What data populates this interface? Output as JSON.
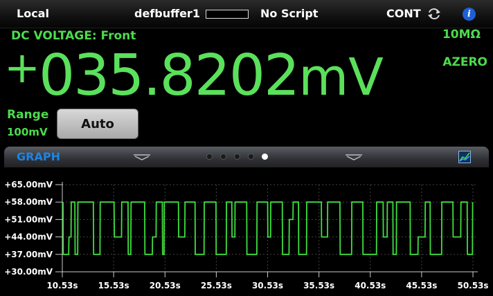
{
  "status_bar": {
    "mode": "Local",
    "buffer_name": "defbuffer1",
    "script": "No Script",
    "trigger_mode": "CONT",
    "sync_icon": "sync-arrows-icon",
    "info_icon": "info-icon",
    "info_glyph": "i"
  },
  "measurement": {
    "function": "DC VOLTAGE: Front",
    "sign": "+",
    "value": "035.8202",
    "unit": "mV",
    "input_impedance": "10MΩ",
    "autozero": "AZERO"
  },
  "range": {
    "label": "Range",
    "value": "100mV",
    "button_label": "Auto"
  },
  "swipe_panel": {
    "title": "GRAPH",
    "page_count": 5,
    "active_page": 5,
    "graph_settings_icon": "graph-icon"
  },
  "colors": {
    "reading": "#5be05b",
    "trace": "#3fe03f",
    "panel_title": "#1d84e3"
  },
  "chart_data": {
    "type": "line",
    "title": "",
    "xlabel": "",
    "ylabel": "",
    "y_tick_labels": [
      "+65.00mV",
      "+58.00mV",
      "+51.00mV",
      "+44.00mV",
      "+37.00mV",
      "+30.00mV"
    ],
    "y_ticks": [
      65,
      58,
      51,
      44,
      37,
      30
    ],
    "x_tick_labels": [
      "10.53s",
      "15.53s",
      "20.53s",
      "25.53s",
      "30.53s",
      "35.53s",
      "40.53s",
      "45.53s",
      "50.53s"
    ],
    "x_ticks": [
      10.53,
      15.53,
      20.53,
      25.53,
      30.53,
      35.53,
      40.53,
      45.53,
      50.53
    ],
    "xlim": [
      10.53,
      51.0
    ],
    "ylim": [
      30,
      65
    ],
    "grid": true,
    "series": [
      {
        "values_x": [
          10.6,
          10.62,
          11.15,
          11.18,
          11.38,
          11.4,
          11.75,
          11.78,
          12.03,
          12.05,
          13.55,
          13.58,
          14.2,
          14.22,
          15.57,
          15.6,
          16.3,
          16.32,
          16.93,
          16.95,
          17.2,
          17.23,
          18.55,
          18.58,
          19.3,
          19.32,
          19.66,
          19.68,
          20.27,
          20.3,
          20.44,
          20.46,
          21.84,
          21.86,
          22.46,
          22.48,
          23.46,
          23.48,
          24.34,
          24.36,
          25.5,
          25.52,
          26.5,
          26.52,
          27.04,
          27.06,
          27.34,
          27.36,
          28.49,
          28.51,
          29.48,
          29.5,
          30.53,
          30.55,
          30.82,
          30.84,
          31.96,
          31.98,
          32.61,
          32.64,
          33.0,
          33.02,
          33.54,
          33.56,
          34.32,
          34.34,
          35.76,
          35.78,
          36.36,
          36.38,
          37.57,
          37.6,
          38.71,
          38.73,
          39.8,
          39.82,
          41.13,
          41.15,
          41.78,
          41.8,
          42.17,
          42.19,
          42.73,
          42.75,
          43.07,
          43.09,
          44.41,
          44.43,
          45.17,
          45.19,
          45.87,
          45.89,
          46.36,
          46.38,
          47.48,
          47.5,
          48.58,
          48.6,
          49.34,
          49.36,
          49.97,
          49.99,
          50.48,
          50.5
        ],
        "values_y": [
          58,
          37,
          37,
          44,
          44,
          58,
          58,
          37,
          37,
          58,
          58,
          37,
          37,
          58,
          58,
          44,
          44,
          58,
          58,
          37,
          37,
          58,
          58,
          37,
          37,
          44,
          44,
          58,
          58,
          37,
          37,
          58,
          58,
          44,
          44,
          58,
          58,
          37,
          37,
          58,
          58,
          37,
          37,
          58,
          58,
          44,
          44,
          58,
          58,
          37,
          37,
          58,
          58,
          44,
          44,
          58,
          58,
          37,
          37,
          51,
          51,
          58,
          58,
          37,
          37,
          58,
          58,
          44,
          44,
          58,
          58,
          37,
          37,
          58,
          58,
          37,
          37,
          58,
          58,
          44,
          44,
          58,
          58,
          37,
          37,
          58,
          58,
          37,
          37,
          44,
          44,
          58,
          58,
          37,
          37,
          58,
          58,
          44,
          44,
          58,
          58,
          37,
          37,
          58
        ]
      }
    ]
  }
}
